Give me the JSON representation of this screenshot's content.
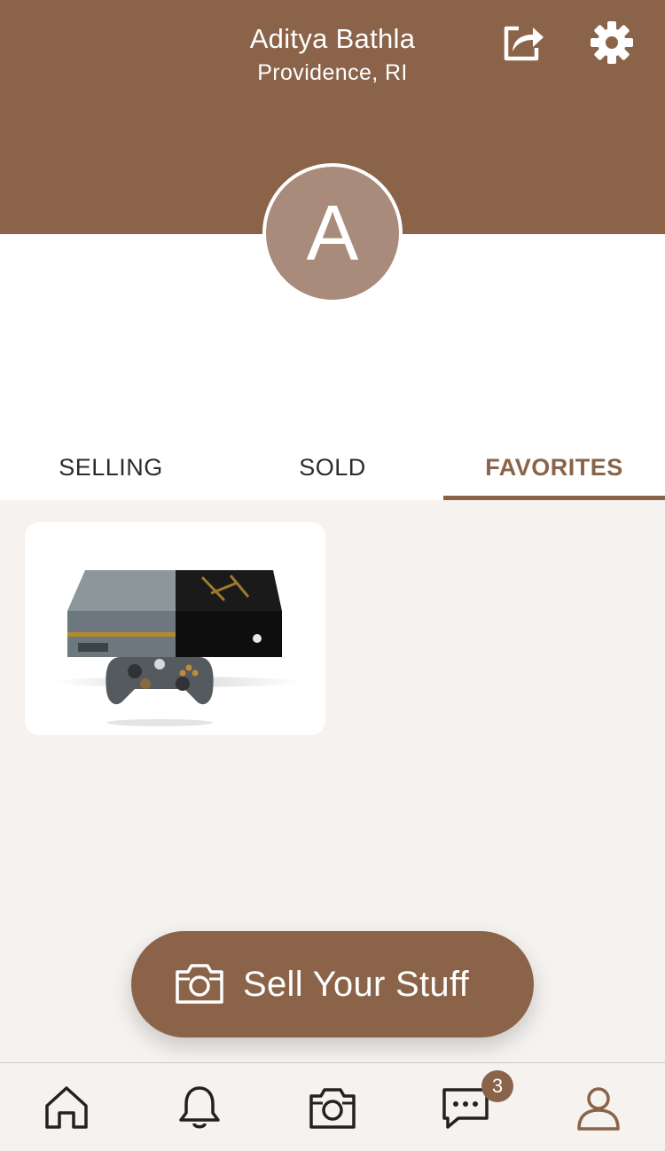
{
  "header": {
    "user_name": "Aditya Bathla",
    "location": "Providence, RI",
    "share_icon": "share-icon",
    "settings_icon": "gear-icon"
  },
  "profile": {
    "avatar_initial": "A"
  },
  "tabs": [
    {
      "label": "SELLING",
      "selected": false
    },
    {
      "label": "SOLD",
      "selected": false
    },
    {
      "label": "FAVORITES",
      "selected": true
    }
  ],
  "favorites": [
    {
      "image": "xbox-one-console-with-controller"
    }
  ],
  "sell_button": {
    "label": "Sell Your Stuff",
    "icon": "camera-icon"
  },
  "bottom_nav": {
    "items": [
      {
        "icon": "home-icon"
      },
      {
        "icon": "bell-icon"
      },
      {
        "icon": "camera-icon"
      },
      {
        "icon": "chat-icon",
        "badge": "3"
      },
      {
        "icon": "profile-icon",
        "active": true
      }
    ]
  },
  "colors": {
    "brand": "#8a6349",
    "avatar": "#a88b7a",
    "background": "#f5f2f0"
  }
}
